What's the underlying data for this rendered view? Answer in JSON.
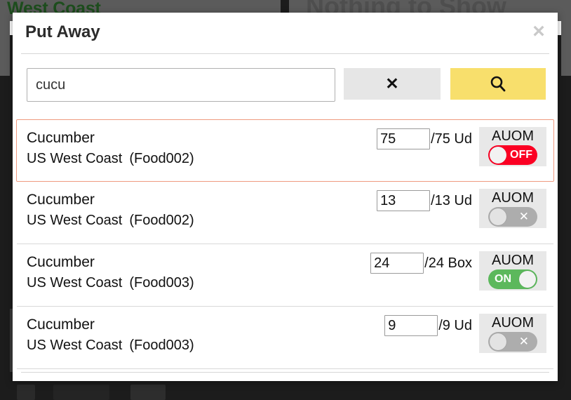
{
  "background": {
    "left_title": "West Coast",
    "empty_state": "Nothing to Show"
  },
  "modal": {
    "title": "Put Away",
    "close_icon": "close-icon",
    "close_label": "×"
  },
  "search": {
    "value": "cucu",
    "placeholder": "",
    "clear_label": "✕",
    "clear_icon": "clear-icon",
    "search_icon": "search-icon",
    "clear_button_color": "#e6e6e6",
    "search_button_color": "#f8df6c"
  },
  "results": [
    {
      "name": "Cucumber",
      "location": "US West Coast",
      "code": "(Food002)",
      "qty_value": "75",
      "qty_total": "/75 Ud",
      "auom_label": "AUOM",
      "auom_state": "off",
      "auom_text": "OFF",
      "selected": true
    },
    {
      "name": "Cucumber",
      "location": "US West Coast",
      "code": "(Food002)",
      "qty_value": "13",
      "qty_total": "/13 Ud",
      "auom_label": "AUOM",
      "auom_state": "disabled",
      "auom_text": "✕",
      "selected": false
    },
    {
      "name": "Cucumber",
      "location": "US West Coast",
      "code": "(Food003)",
      "qty_value": "24",
      "qty_total": "/24 Box",
      "auom_label": "AUOM",
      "auom_state": "on",
      "auom_text": "ON",
      "selected": false
    },
    {
      "name": "Cucumber",
      "location": "US West Coast",
      "code": "(Food003)",
      "qty_value": "9",
      "qty_total": "/9 Ud",
      "auom_label": "AUOM",
      "auom_state": "disabled",
      "auom_text": "✕",
      "selected": false
    }
  ],
  "colors": {
    "toggle_off": "#fb0023",
    "toggle_on": "#5cb85c",
    "toggle_disabled": "#adadad",
    "selected_border": "#ef9a80",
    "accent_yellow": "#f8df6c",
    "title_green": "#1d4d1d"
  }
}
